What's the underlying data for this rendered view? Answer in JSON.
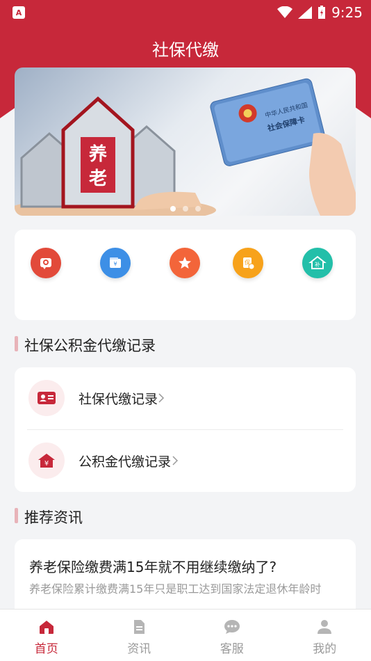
{
  "status_bar": {
    "time": "9:25",
    "app_icon_text": "A"
  },
  "header": {
    "title": "社保代缴"
  },
  "banner": {
    "carousel_count": 3,
    "active_index": 0,
    "seal_text_1": "中华人民共和国",
    "seal_text_2": "社会保障卡",
    "house_text": "养老"
  },
  "quick_actions": [
    {
      "icon": "payment-icon",
      "color": "#e24a3a"
    },
    {
      "icon": "wallet-yuan-icon",
      "color": "#3d8fe6"
    },
    {
      "icon": "star-icon",
      "color": "#f3653a"
    },
    {
      "icon": "insurance-icon",
      "color": "#f7a21b"
    },
    {
      "icon": "housing-fund-icon",
      "color": "#23bfa9"
    }
  ],
  "records_section": {
    "title": "社保公积金代缴记录",
    "items": [
      {
        "label": "社保代缴记录",
        "icon": "id-card-icon"
      },
      {
        "label": "公积金代缴记录",
        "icon": "house-yuan-icon"
      }
    ]
  },
  "news_section": {
    "title": "推荐资讯",
    "items": [
      {
        "title": "养老保险缴费满15年就不用继续缴纳了?",
        "summary": "养老保险累计缴费满15年只是职工达到国家法定退休年龄时"
      }
    ]
  },
  "tab_bar": {
    "tabs": [
      {
        "label": "首页",
        "icon": "home-icon",
        "active": true
      },
      {
        "label": "资讯",
        "icon": "document-icon",
        "active": false
      },
      {
        "label": "客服",
        "icon": "chat-icon",
        "active": false
      },
      {
        "label": "我的",
        "icon": "user-icon",
        "active": false
      }
    ]
  },
  "colors": {
    "brand": "#c7283a",
    "background": "#f3f4f6"
  }
}
